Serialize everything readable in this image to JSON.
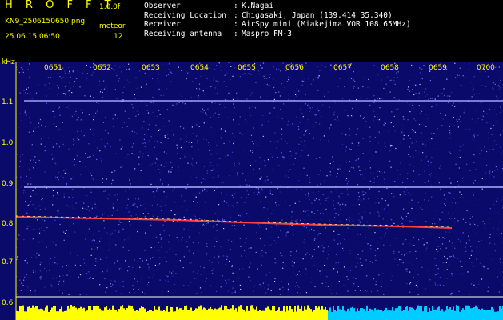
{
  "header": {
    "title": "H R O F F T",
    "version": "1.0.0f",
    "filename": "KN9_2506150650.png",
    "datetime": "25.06.15 06:50",
    "meteor_label": "meteor",
    "meteor_count": "12"
  },
  "info": {
    "rows": [
      {
        "key": "Observer",
        "value": "K.Nagai"
      },
      {
        "key": "Receiving Location",
        "value": "Chigasaki, Japan (139.414 35.340)"
      },
      {
        "key": "Receiver",
        "value": "AirSpy mini (Miakejima VOR 108.65MHz)"
      },
      {
        "key": "Receiving antenna",
        "value": "Maspro FM-3"
      }
    ],
    "separator": ":"
  },
  "axis": {
    "y_unit": "kHz",
    "y_ticks": [
      "1.1",
      "1.0",
      "0.9",
      "0.8",
      "0.7",
      "0.6"
    ],
    "x_ticks": [
      "0651",
      "0652",
      "0653",
      "0654",
      "0655",
      "0656",
      "0657",
      "0658",
      "0659",
      "0700"
    ]
  },
  "colors": {
    "background": "#0a0a6a",
    "label": "#ffff00",
    "signal_line": "#a0a0ff",
    "trace": "#ff4040",
    "bottom_yellow": "#ffff00",
    "bottom_cyan": "#00ccff"
  }
}
